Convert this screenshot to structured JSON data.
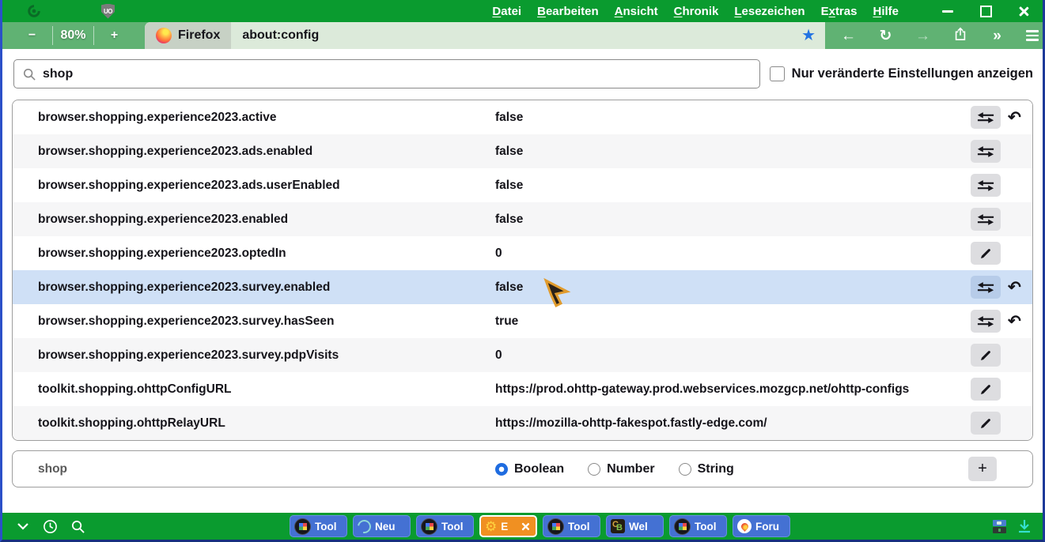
{
  "titlebar": {
    "menu_items": [
      {
        "label": "Datei",
        "underline_index": 0
      },
      {
        "label": "Bearbeiten",
        "underline_index": 0
      },
      {
        "label": "Ansicht",
        "underline_index": 0
      },
      {
        "label": "Chronik",
        "underline_index": 0
      },
      {
        "label": "Lesezeichen",
        "underline_index": 0
      },
      {
        "label": "Extras",
        "underline_index": 1
      },
      {
        "label": "Hilfe",
        "underline_index": 0
      }
    ],
    "icons": [
      "green-swirl-logo",
      "ublock-origin-shield"
    ],
    "shield_text": "UO"
  },
  "toolbar": {
    "zoom_out_label": "−",
    "zoom_level": "80%",
    "zoom_in_label": "+",
    "tab_label": "Firefox",
    "url": "about:config",
    "nav_icons": [
      "back-icon",
      "reload-icon",
      "forward-icon",
      "share-icon",
      "overflow-chevrons-icon",
      "menu-icon"
    ],
    "overflow_glyph": "»",
    "back_glyph": "←",
    "forward_glyph": "→",
    "reload_glyph": "↻",
    "star_glyph": "★"
  },
  "search": {
    "value": "shop",
    "filter_checkbox_label": "Nur veränderte Einstellungen anzeigen",
    "filter_checked": false
  },
  "prefs": {
    "rows": [
      {
        "name": "browser.shopping.experience2023.active",
        "value": "false",
        "actions": [
          "toggle",
          "reset"
        ],
        "highlighted": false
      },
      {
        "name": "browser.shopping.experience2023.ads.enabled",
        "value": "false",
        "actions": [
          "toggle"
        ],
        "highlighted": false
      },
      {
        "name": "browser.shopping.experience2023.ads.userEnabled",
        "value": "false",
        "actions": [
          "toggle"
        ],
        "highlighted": false
      },
      {
        "name": "browser.shopping.experience2023.enabled",
        "value": "false",
        "actions": [
          "toggle"
        ],
        "highlighted": false
      },
      {
        "name": "browser.shopping.experience2023.optedIn",
        "value": "0",
        "actions": [
          "edit"
        ],
        "highlighted": false
      },
      {
        "name": "browser.shopping.experience2023.survey.enabled",
        "value": "false",
        "actions": [
          "toggle",
          "reset"
        ],
        "highlighted": true
      },
      {
        "name": "browser.shopping.experience2023.survey.hasSeen",
        "value": "true",
        "actions": [
          "toggle",
          "reset"
        ],
        "highlighted": false
      },
      {
        "name": "browser.shopping.experience2023.survey.pdpVisits",
        "value": "0",
        "actions": [
          "edit"
        ],
        "highlighted": false
      },
      {
        "name": "toolkit.shopping.ohttpConfigURL",
        "value": "https://prod.ohttp-gateway.prod.webservices.mozgcp.net/ohttp-configs",
        "actions": [
          "edit"
        ],
        "highlighted": false
      },
      {
        "name": "toolkit.shopping.ohttpRelayURL",
        "value": "https://mozilla-ohttp-fakespot.fastly-edge.com/",
        "actions": [
          "edit"
        ],
        "highlighted": false
      }
    ],
    "reset_glyph": "↶"
  },
  "add_row": {
    "name": "shop",
    "type_options": [
      {
        "label": "Boolean",
        "selected": true
      },
      {
        "label": "Number",
        "selected": false
      },
      {
        "label": "String",
        "selected": false
      }
    ],
    "add_button_label": "+"
  },
  "taskbar": {
    "buttons": [
      {
        "label": "Tool",
        "icon": "grid-circle",
        "active": false,
        "has_close": false
      },
      {
        "label": "Neu",
        "icon": "swirl",
        "active": false,
        "has_close": false
      },
      {
        "label": "Tool",
        "icon": "grid-circle",
        "active": false,
        "has_close": false
      },
      {
        "label": "E",
        "icon": "gear",
        "active": true,
        "has_close": true
      },
      {
        "label": "Tool",
        "icon": "grid-circle",
        "active": false,
        "has_close": false
      },
      {
        "label": "Wel",
        "icon": "cb-badge",
        "active": false,
        "has_close": false
      },
      {
        "label": "Tool",
        "icon": "grid-circle",
        "active": false,
        "has_close": false
      },
      {
        "label": "Foru",
        "icon": "flame",
        "active": false,
        "has_close": false
      }
    ],
    "gear_glyph": "⚙"
  },
  "colors": {
    "titlebar_green": "#0a9b2f",
    "toolbar_green": "#60b273",
    "urlbar_bg": "#dceada",
    "highlight_row": "#cfe0f6",
    "accent_blue": "#1f6ce0",
    "star_blue": "#2273e2",
    "taskbar_blue": "#4471d3",
    "active_orange": "#f09022",
    "window_border_blue": "#2b50c8"
  }
}
